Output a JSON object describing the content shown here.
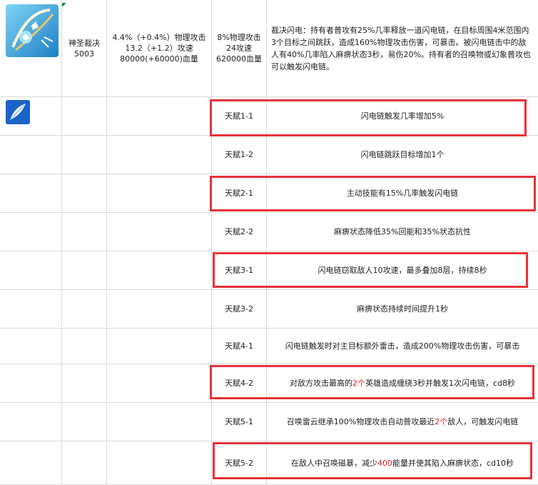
{
  "header": {
    "name": "神圣裁决",
    "id": "5003",
    "growth_lines": [
      "4.4%（+0.4%）物理攻击",
      "13.2（+1.2）攻速",
      "80000(+60000)血量"
    ],
    "base_lines": [
      "8%物理攻击",
      "24攻速",
      "620000血量"
    ],
    "description": "裁决闪电：持有者普攻有25%几率释放一道闪电链，在目标周围4米范围内3个目标之间跳跃，造成160%物理攻击伤害，可暴击。被闪电链击中的敌人有40%几率陷入麻痹状态3秒，易伤20%。持有者的召唤物或幻象普攻也可以触发闪电链。"
  },
  "talents": [
    {
      "label": "天赋1-1",
      "segments": [
        {
          "text": "闪电链触发几率增加5%",
          "red": false
        }
      ]
    },
    {
      "label": "天赋1-2",
      "segments": [
        {
          "text": "闪电链跳跃目标增加1个",
          "red": false
        }
      ]
    },
    {
      "label": "天赋2-1",
      "segments": [
        {
          "text": "主动技能有15%几率触发闪电链",
          "red": false
        }
      ]
    },
    {
      "label": "天赋2-2",
      "segments": [
        {
          "text": "麻痹状态降低35%回能和35%状态抗性",
          "red": false
        }
      ]
    },
    {
      "label": "天赋3-1",
      "segments": [
        {
          "text": "闪电链窃取敌人10攻速，最多叠加8层，持续8秒",
          "red": false
        }
      ]
    },
    {
      "label": "天赋3-2",
      "segments": [
        {
          "text": "麻痹状态持续时间提升1秒",
          "red": false
        }
      ]
    },
    {
      "label": "天赋4-1",
      "segments": [
        {
          "text": "闪电链触发时对主目标额外雷击，造成200%物理攻击伤害，可暴击",
          "red": false
        }
      ]
    },
    {
      "label": "天赋4-2",
      "segments": [
        {
          "text": "对敌方攻击最高的",
          "red": false
        },
        {
          "text": "2个",
          "red": true
        },
        {
          "text": "英雄造成缠绕3秒并触发1次闪电链，cd8秒",
          "red": false
        }
      ]
    },
    {
      "label": "天赋5-1",
      "segments": [
        {
          "text": "召唤雷云继承100%物理攻击自动普攻最近",
          "red": false
        },
        {
          "text": "2个",
          "red": true
        },
        {
          "text": "敌人，可触发闪电链",
          "red": false
        }
      ]
    },
    {
      "label": "天赋5-2",
      "segments": [
        {
          "text": "在敌人中召唤磁暴，减少",
          "red": false
        },
        {
          "text": "400",
          "red": true
        },
        {
          "text": "能量并使其陷入麻痹状态，cd10秒",
          "red": false
        }
      ]
    }
  ],
  "icons": {
    "weapon": "holy-bow-weapon-icon",
    "talent": "feather-icon"
  },
  "colors": {
    "highlight_box": "#e8323a",
    "highlight_text": "#e02020",
    "grid": "#d9d9d9"
  }
}
